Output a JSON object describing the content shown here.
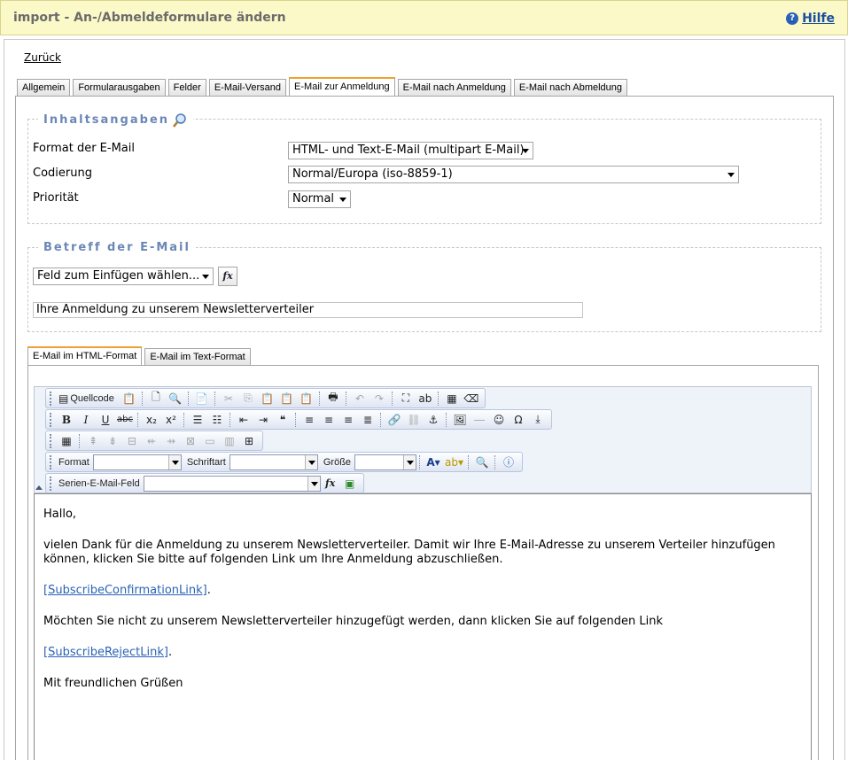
{
  "header": {
    "title": "import - An-/Abmeldeformulare ändern",
    "help_label": "Hilfe"
  },
  "back_link": "Zurück",
  "tabs": [
    {
      "label": "Allgemein"
    },
    {
      "label": "Formularausgaben"
    },
    {
      "label": "Felder"
    },
    {
      "label": "E-Mail-Versand"
    },
    {
      "label": "E-Mail zur Anmeldung",
      "active": true
    },
    {
      "label": "E-Mail nach Anmeldung"
    },
    {
      "label": "E-Mail nach Abmeldung"
    }
  ],
  "inhalt": {
    "legend": "Inhaltsangaben",
    "format_label": "Format der E-Mail",
    "format_value": "HTML- und Text-E-Mail (multipart E-Mail)",
    "coding_label": "Codierung",
    "coding_value": "Normal/Europa (iso-8859-1)",
    "priority_label": "Priorität",
    "priority_value": "Normal"
  },
  "betreff": {
    "legend": "Betreff der E-Mail",
    "field_select": "Feld zum Einfügen wählen...",
    "fx_label": "fx",
    "subject": "Ihre Anmeldung zu unserem Newsletterverteiler"
  },
  "editor_tabs": [
    {
      "label": "E-Mail im HTML-Format",
      "active": true
    },
    {
      "label": "E-Mail im Text-Format"
    }
  ],
  "toolbar": {
    "source_label": "Quellcode",
    "format_label": "Format",
    "font_label": "Schriftart",
    "size_label": "Größe",
    "serial_label": "Serien-E-Mail-Feld",
    "bold": "B",
    "italic": "I",
    "underline": "U",
    "strike": "abc",
    "omega": "Ω",
    "fx": "fx"
  },
  "body": {
    "greeting": "Hallo,",
    "text1": "vielen Dank für die Anmeldung zu unserem Newsletterverteiler. Damit wir Ihre E-Mail-Adresse zu unserem Verteiler hinzufügen können, klicken Sie bitte auf folgenden Link um Ihre Anmeldung abzuschließen.",
    "link1": "[SubscribeConfirmationLink]",
    "text2": "Möchten Sie nicht zu unserem Newsletterverteiler hinzugefügt werden, dann klicken Sie auf folgenden Link",
    "link2": "[SubscribeRejectLink]",
    "closing": "Mit freundlichen Grüßen"
  }
}
